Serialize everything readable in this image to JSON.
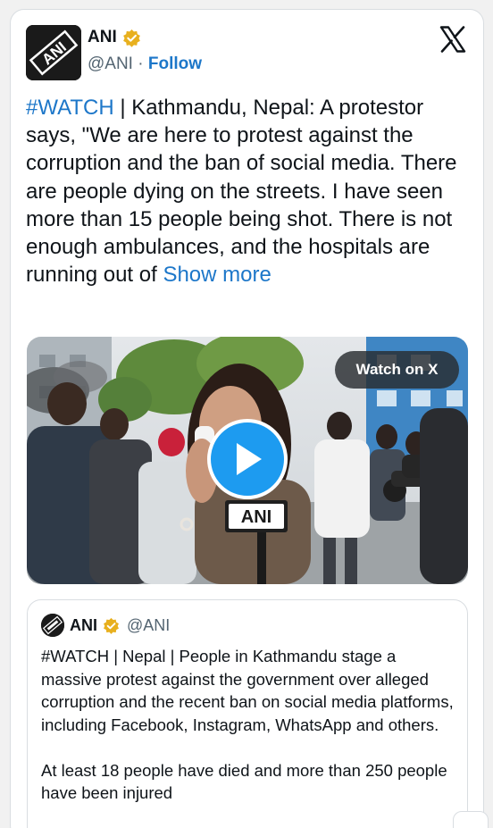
{
  "author": {
    "name": "ANI",
    "handle": "@ANI",
    "separator": "·",
    "follow_label": "Follow",
    "avatar_logo_text": "ANI",
    "verified": true
  },
  "tweet": {
    "hashtag": "#WATCH",
    "body": " | Kathmandu, Nepal: A protestor says, \"We are here to protest against the corruption and the ban of social media. There are people dying on the streets. I have seen more than 15 people being shot. There is not enough ambulances, and the hospitals are running out of ",
    "show_more": "Show more"
  },
  "media": {
    "watch_label": "Watch on X",
    "mic_logo_text": "ANI",
    "icons": [
      "play-icon"
    ]
  },
  "quote": {
    "name": "ANI",
    "handle": "@ANI",
    "paragraph_1": "#WATCH | Nepal | People in Kathmandu stage a massive protest against the government over alleged corruption and the recent ban on social media platforms, including Facebook, Instagram, WhatsApp and others.",
    "paragraph_2": "At least 18 people have died and more than 250 people have been injured"
  },
  "colors": {
    "link": "#1d77c9",
    "verified_badge": "#e8b01e",
    "play_button": "#1d9bf0",
    "text": "#0f1419",
    "muted": "#536471"
  }
}
